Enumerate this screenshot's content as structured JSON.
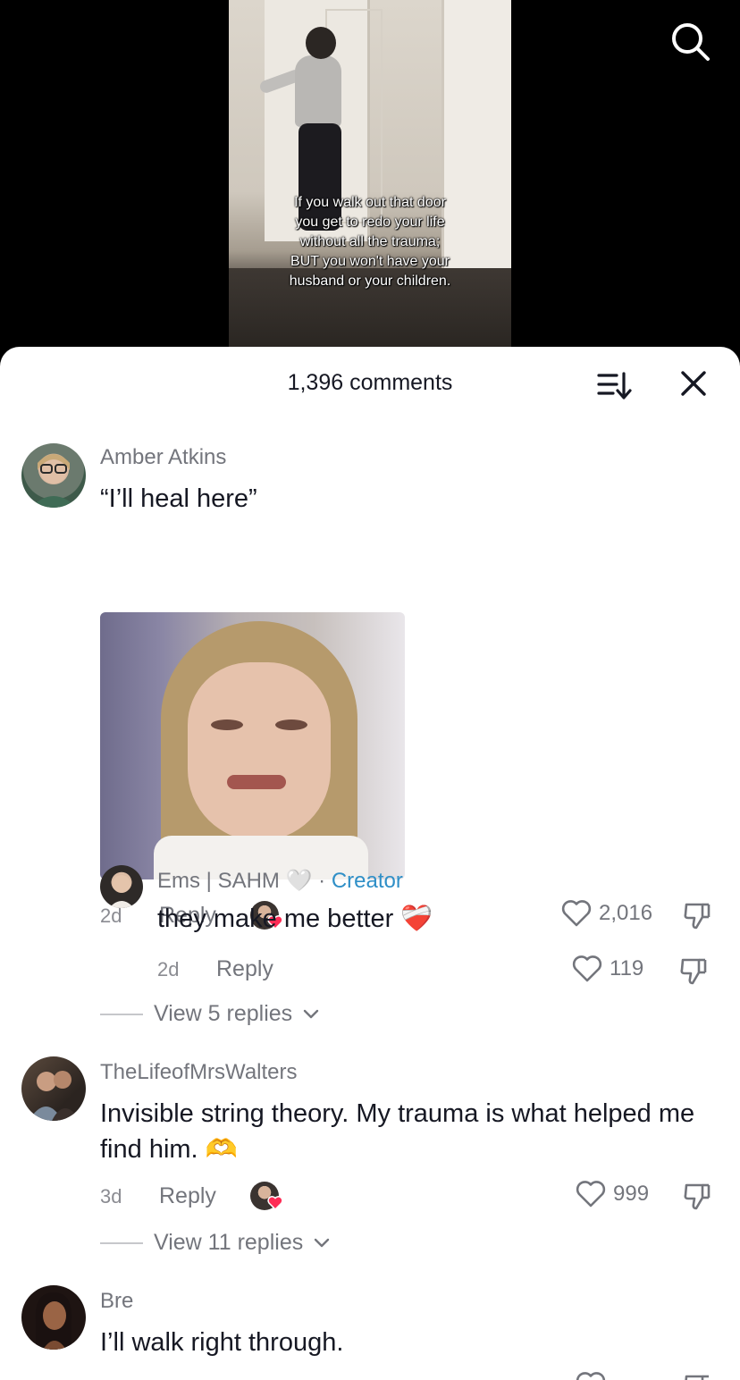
{
  "video": {
    "caption": "If you walk out that door\nyou get to redo your life\nwithout all the trauma;\nBUT you won't have your\nhusband or your children."
  },
  "header": {
    "comment_count": "1,396 comments"
  },
  "comments": [
    {
      "username": "Amber Atkins",
      "text": "“I’ll heal here”",
      "time": "2d",
      "reply_label": "Reply",
      "likes": "2,016",
      "liked_by_creator": true
    },
    {
      "username": "Ems | SAHM",
      "username_emoji": "🤍",
      "separator": "·",
      "creator_label": "Creator",
      "text": "they make me better",
      "text_emoji": "❤️‍🩹",
      "time": "2d",
      "reply_label": "Reply",
      "likes": "119",
      "view_replies": "View 5 replies"
    },
    {
      "username": "TheLifeofMrsWalters",
      "text": "Invisible string theory. My trauma is what helped me find him.",
      "text_emoji": "🫶",
      "time": "3d",
      "reply_label": "Reply",
      "likes": "999",
      "liked_by_creator": true,
      "view_replies": "View 11 replies"
    },
    {
      "username": "Bre",
      "text": "I’ll walk right through."
    }
  ],
  "icons": {
    "search": "search-icon",
    "sort": "sort-icon",
    "close": "close-icon",
    "like": "heart-outline-icon",
    "dislike": "thumbs-down-icon",
    "chevron": "chevron-down-icon",
    "creator_heart": "red-heart-icon"
  },
  "colors": {
    "creator_tag": "#2f8fc7",
    "liked_heart": "#fe2c55"
  }
}
